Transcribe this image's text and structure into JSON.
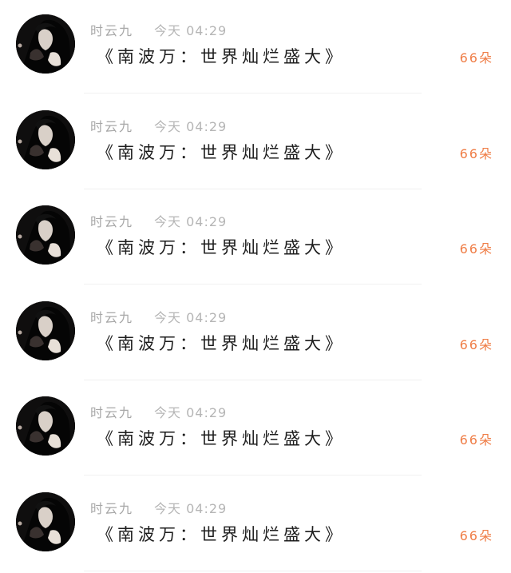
{
  "messages": [
    {
      "author": "时云九",
      "time": "今天 04:29",
      "text": "《南波万：世界灿烂盛大》",
      "count": "66朵"
    },
    {
      "author": "时云九",
      "time": "今天 04:29",
      "text": "《南波万：世界灿烂盛大》",
      "count": "66朵"
    },
    {
      "author": "时云九",
      "time": "今天 04:29",
      "text": "《南波万：世界灿烂盛大》",
      "count": "66朵"
    },
    {
      "author": "时云九",
      "time": "今天 04:29",
      "text": "《南波万：世界灿烂盛大》",
      "count": "66朵"
    },
    {
      "author": "时云九",
      "time": "今天 04:29",
      "text": "《南波万：世界灿烂盛大》",
      "count": "66朵"
    },
    {
      "author": "时云九",
      "time": "今天 04:29",
      "text": "《南波万：世界灿烂盛大》",
      "count": "66朵"
    }
  ],
  "colors": {
    "author": "#a8a8a8",
    "time": "#b5b5b5",
    "message": "#1d1d1d",
    "count": "#ef7d46"
  }
}
